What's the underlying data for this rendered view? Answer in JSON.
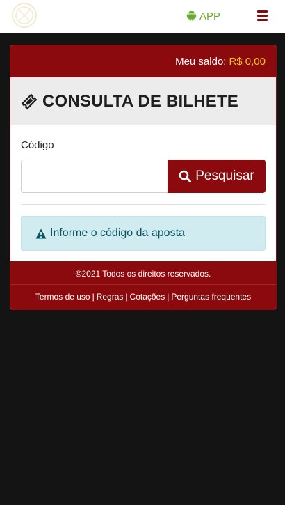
{
  "header": {
    "app_label": "APP"
  },
  "balance": {
    "label": "Meu saldo:",
    "value": "R$ 0,00"
  },
  "page": {
    "title": "CONSULTA DE BILHETE"
  },
  "form": {
    "code_label": "Código",
    "code_value": "",
    "search_label": "Pesquisar"
  },
  "alert": {
    "message": "Informe o código da aposta"
  },
  "footer": {
    "copyright": "©2021 Todos os direitos reservados.",
    "links": [
      "Termos de uso",
      "Regras",
      "Cotações",
      "Perguntas frequentes"
    ],
    "separator": "|"
  },
  "colors": {
    "brand": "#8b0a0e",
    "app_green": "#6aa832",
    "balance_value": "#f5c518",
    "alert_bg": "#d1ecf1",
    "alert_text": "#0c5460",
    "page_bg": "#141414"
  },
  "icons": {
    "app": "android-icon",
    "menu": "hamburger-menu-icon",
    "title": "ticket-icon",
    "search": "search-icon",
    "alert": "warning-icon"
  }
}
